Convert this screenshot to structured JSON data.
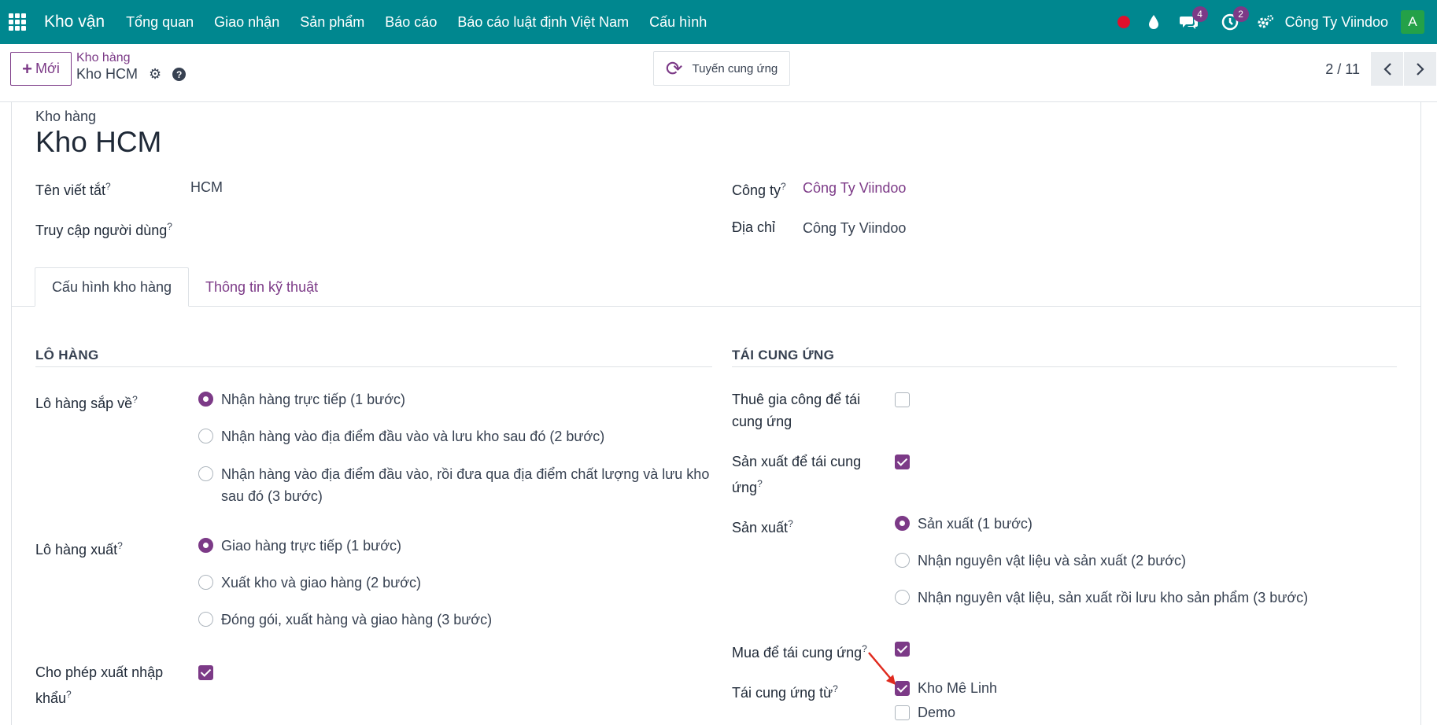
{
  "navbar": {
    "brand": "Kho vận",
    "menu": [
      "Tổng quan",
      "Giao nhận",
      "Sản phẩm",
      "Báo cáo",
      "Báo cáo luật định Việt Nam",
      "Cấu hình"
    ],
    "messages_count": "4",
    "activities_count": "2",
    "company": "Công Ty Viindoo",
    "avatar_letter": "A"
  },
  "control": {
    "new_label": "Mới",
    "breadcrumb_parent": "Kho hàng",
    "breadcrumb_current": "Kho HCM",
    "route_button": "Tuyến cung ứng",
    "pager": "2 / 11"
  },
  "form": {
    "top_label": "Kho hàng",
    "title": "Kho HCM",
    "short_name_label": "Tên viết tắt",
    "short_name_value": "HCM",
    "user_access_label": "Truy cập người dùng",
    "company_label": "Công ty",
    "company_value": "Công Ty Viindoo",
    "address_label": "Địa chỉ",
    "address_value": "Công Ty Viindoo",
    "help_mark": "?"
  },
  "tabs": [
    "Cấu hình kho hàng",
    "Thông tin kỹ thuật"
  ],
  "shipments": {
    "section_title": "LÔ HÀNG",
    "incoming_label": "Lô hàng sắp về",
    "incoming_options": [
      {
        "label": "Nhận hàng trực tiếp (1 bước)",
        "checked": true
      },
      {
        "label": "Nhận hàng vào địa điểm đầu vào và lưu kho sau đó (2 bước)",
        "checked": false
      },
      {
        "label": "Nhận hàng vào địa điểm đầu vào, rồi đưa qua địa điểm chất lượng và lưu kho sau đó (3 bước)",
        "checked": false
      }
    ],
    "outgoing_label": "Lô hàng xuất",
    "outgoing_options": [
      {
        "label": "Giao hàng trực tiếp (1 bước)",
        "checked": true
      },
      {
        "label": "Xuất kho và giao hàng (2 bước)",
        "checked": false
      },
      {
        "label": "Đóng gói, xuất hàng và giao hàng (3 bước)",
        "checked": false
      }
    ],
    "import_export_label": "Cho phép xuất nhập khẩu",
    "import_export_checked": true
  },
  "resupply": {
    "section_title": "TÁI CUNG ỨNG",
    "subcontract_label": "Thuê gia công để tái cung ứng",
    "subcontract_checked": false,
    "manufacture_resupply_label": "Sản xuất để tái cung ứng",
    "manufacture_resupply_checked": true,
    "manufacture_label": "Sản xuất",
    "manufacture_options": [
      {
        "label": "Sản xuất (1 bước)",
        "checked": true
      },
      {
        "label": "Nhận nguyên vật liệu và sản xuất (2 bước)",
        "checked": false
      },
      {
        "label": "Nhận nguyên vật liệu, sản xuất rồi lưu kho sản phẩm (3 bước)",
        "checked": false
      }
    ],
    "buy_label": "Mua để tái cung ứng",
    "buy_checked": true,
    "resupply_from_label": "Tái cung ứng từ",
    "resupply_from": [
      {
        "label": "Kho Mê Linh",
        "checked": true
      },
      {
        "label": "Demo",
        "checked": false
      }
    ]
  },
  "colors": {
    "navbar": "#00878f",
    "accent": "#7c3a87",
    "arrow": "#e02a1e"
  }
}
